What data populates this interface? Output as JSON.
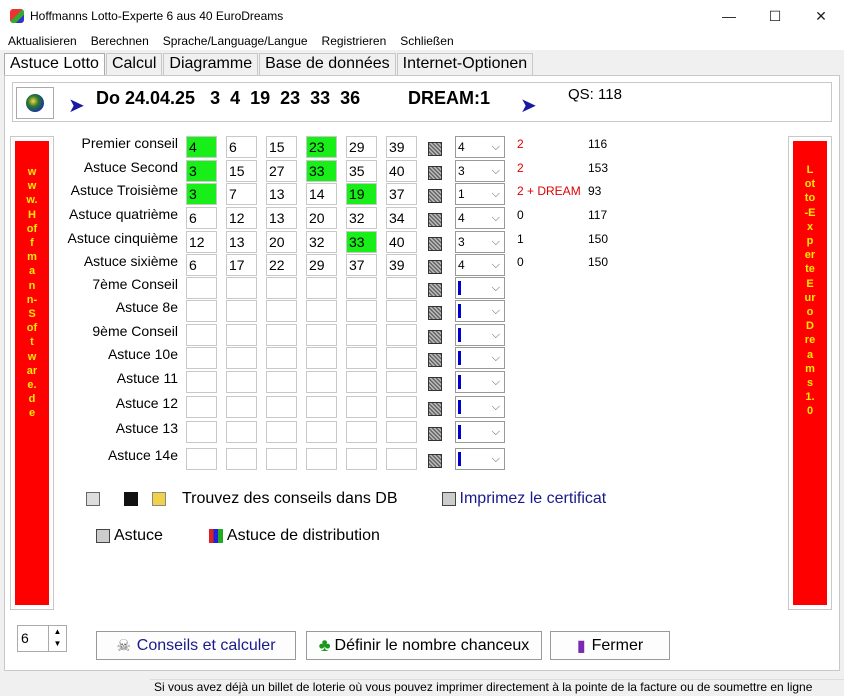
{
  "window": {
    "title": "Hoffmanns Lotto-Experte  6 aus 40 EuroDreams",
    "minimize": "—",
    "maximize": "☐",
    "close": "✕"
  },
  "menu": [
    "Aktualisieren",
    "Berechnen",
    "Sprache/Language/Langue",
    "Registrieren",
    "Schließen"
  ],
  "tabs": [
    "Astuce Lotto",
    "Calcul",
    "Diagramme",
    "Base de données",
    "Internet-Optionen"
  ],
  "draw": {
    "date": "Do 24.04.25",
    "numbers": "3  4  19  23  33  36",
    "dream": "DREAM:1",
    "qs": "QS: 118"
  },
  "side_left_text": "www.Hoffmann-Software.de",
  "side_right_text": "Lotto-Experte Euro Dreams 1.0",
  "rows": [
    {
      "label": "Premier conseil",
      "nums": [
        "4",
        "6",
        "15",
        "23",
        "29",
        "39"
      ],
      "hits": [
        true,
        false,
        false,
        true,
        false,
        false
      ],
      "combo": "4",
      "count": "2",
      "count_red": true,
      "sum": "116"
    },
    {
      "label": "Astuce Second",
      "nums": [
        "3",
        "15",
        "27",
        "33",
        "35",
        "40"
      ],
      "hits": [
        true,
        false,
        false,
        true,
        false,
        false
      ],
      "combo": "3",
      "count": "2",
      "count_red": true,
      "sum": "153"
    },
    {
      "label": "Astuce Troisième",
      "nums": [
        "3",
        "7",
        "13",
        "14",
        "19",
        "37"
      ],
      "hits": [
        true,
        false,
        false,
        false,
        true,
        false
      ],
      "combo": "1",
      "count": "2 + DREAM",
      "count_red": true,
      "sum": "93"
    },
    {
      "label": "Astuce quatrième",
      "nums": [
        "6",
        "12",
        "13",
        "20",
        "32",
        "34"
      ],
      "hits": [
        false,
        false,
        false,
        false,
        false,
        false
      ],
      "combo": "4",
      "count": "0",
      "count_red": false,
      "sum": "117"
    },
    {
      "label": "Astuce cinquième",
      "nums": [
        "12",
        "13",
        "20",
        "32",
        "33",
        "40"
      ],
      "hits": [
        false,
        false,
        false,
        false,
        true,
        false
      ],
      "combo": "3",
      "count": "1",
      "count_red": false,
      "sum": "150"
    },
    {
      "label": "Astuce sixième",
      "nums": [
        "6",
        "17",
        "22",
        "29",
        "37",
        "39"
      ],
      "hits": [
        false,
        false,
        false,
        false,
        false,
        false
      ],
      "combo": "4",
      "count": "0",
      "count_red": false,
      "sum": "150"
    },
    {
      "label": "7ème Conseil",
      "nums": [
        "",
        "",
        "",
        "",
        "",
        ""
      ],
      "hits": [
        false,
        false,
        false,
        false,
        false,
        false
      ],
      "combo": "",
      "count": "",
      "count_red": false,
      "sum": ""
    },
    {
      "label": "Astuce 8e",
      "nums": [
        "",
        "",
        "",
        "",
        "",
        ""
      ],
      "hits": [
        false,
        false,
        false,
        false,
        false,
        false
      ],
      "combo": "",
      "count": "",
      "count_red": false,
      "sum": ""
    },
    {
      "label": "9ème Conseil",
      "nums": [
        "",
        "",
        "",
        "",
        "",
        ""
      ],
      "hits": [
        false,
        false,
        false,
        false,
        false,
        false
      ],
      "combo": "",
      "count": "",
      "count_red": false,
      "sum": ""
    },
    {
      "label": "Astuce 10e",
      "nums": [
        "",
        "",
        "",
        "",
        "",
        ""
      ],
      "hits": [
        false,
        false,
        false,
        false,
        false,
        false
      ],
      "combo": "",
      "count": "",
      "count_red": false,
      "sum": ""
    },
    {
      "label": "Astuce 11",
      "nums": [
        "",
        "",
        "",
        "",
        "",
        ""
      ],
      "hits": [
        false,
        false,
        false,
        false,
        false,
        false
      ],
      "combo": "",
      "count": "",
      "count_red": false,
      "sum": ""
    },
    {
      "label": "Astuce 12",
      "nums": [
        "",
        "",
        "",
        "",
        "",
        ""
      ],
      "hits": [
        false,
        false,
        false,
        false,
        false,
        false
      ],
      "combo": "",
      "count": "",
      "count_red": false,
      "sum": ""
    },
    {
      "label": "Astuce 13",
      "nums": [
        "",
        "",
        "",
        "",
        "",
        ""
      ],
      "hits": [
        false,
        false,
        false,
        false,
        false,
        false
      ],
      "combo": "",
      "count": "",
      "count_red": false,
      "sum": ""
    },
    {
      "label": "Astuce 14e",
      "nums": [
        "",
        "",
        "",
        "",
        "",
        ""
      ],
      "hits": [
        false,
        false,
        false,
        false,
        false,
        false
      ],
      "combo": "",
      "count": "",
      "count_red": false,
      "sum": ""
    }
  ],
  "tools": {
    "find_db": "Trouvez des conseils dans DB",
    "print_cert": "Imprimez le certificat",
    "astuce": "Astuce",
    "distribution": "Astuce de distribution"
  },
  "spinner_value": "6",
  "buttons": {
    "calc": "Conseils et calculer",
    "lucky": "Définir le nombre chanceux",
    "close": "Fermer"
  },
  "status": "Si vous avez déjà un billet de loterie où vous pouvez imprimer directement à la pointe de la facture ou de soumettre en ligne",
  "colors": {
    "hit": "#18ee18",
    "side_red": "#ff0000",
    "side_text": "#ffea00",
    "count_red": "#e00000"
  }
}
